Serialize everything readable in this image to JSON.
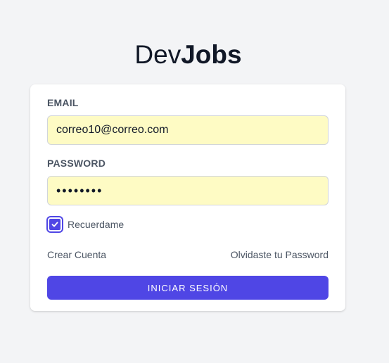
{
  "logo": {
    "light": "Dev",
    "bold": "Jobs"
  },
  "form": {
    "email_label": "EMAIL",
    "email_value": "correo10@correo.com",
    "password_label": "PASSWORD",
    "password_value": "••••••••",
    "remember_label": "Recuerdame",
    "remember_checked": true,
    "create_account_link": "Crear Cuenta",
    "forgot_password_link": "Olvidaste tu Password",
    "submit_label": "INICIAR SESIÓN"
  },
  "colors": {
    "accent": "#4f46e5",
    "input_autofill_bg": "#fefbc4",
    "page_bg": "#f3f4f6",
    "text_muted": "#4b5563"
  }
}
